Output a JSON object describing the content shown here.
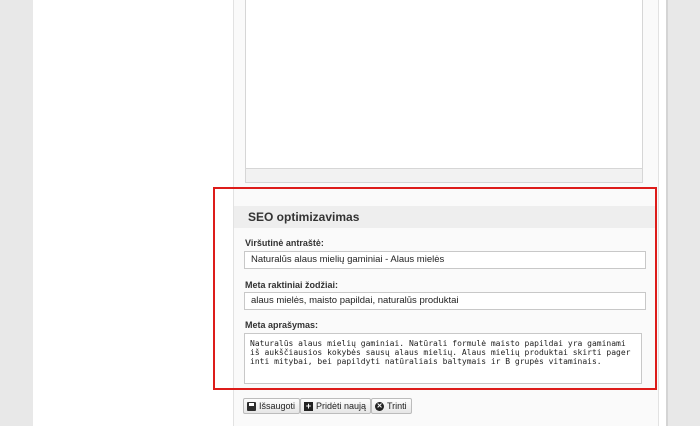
{
  "seo": {
    "title": "SEO optimizavimas",
    "heading_label": "Viršutinė antraštė:",
    "heading_value": "Naturalūs alaus mielių gaminiai - Alaus mielės",
    "keywords_label": "Meta raktiniai žodžiai:",
    "keywords_value": "alaus mielės, maisto papildai, naturalūs produktai",
    "description_label": "Meta aprašymas:",
    "description_value": "Naturalūs alaus mielių gaminiai. Natūrali formulė maisto papildai yra gaminami iš aukščiausios kokybės sausų alaus mielių. Alaus mielių produktai skirti pagerinti mitybai, bei papildyti natūraliais baltymais ir B grupės vitaminais."
  },
  "actions": {
    "save_label": "Išsaugoti",
    "add_label": "Pridėti naują",
    "delete_label": "Trinti"
  },
  "icons": {
    "save": "floppy-disk-icon",
    "add": "plus-icon",
    "delete": "close-circle-icon"
  },
  "colors": {
    "highlight": "#dd1c1a"
  }
}
